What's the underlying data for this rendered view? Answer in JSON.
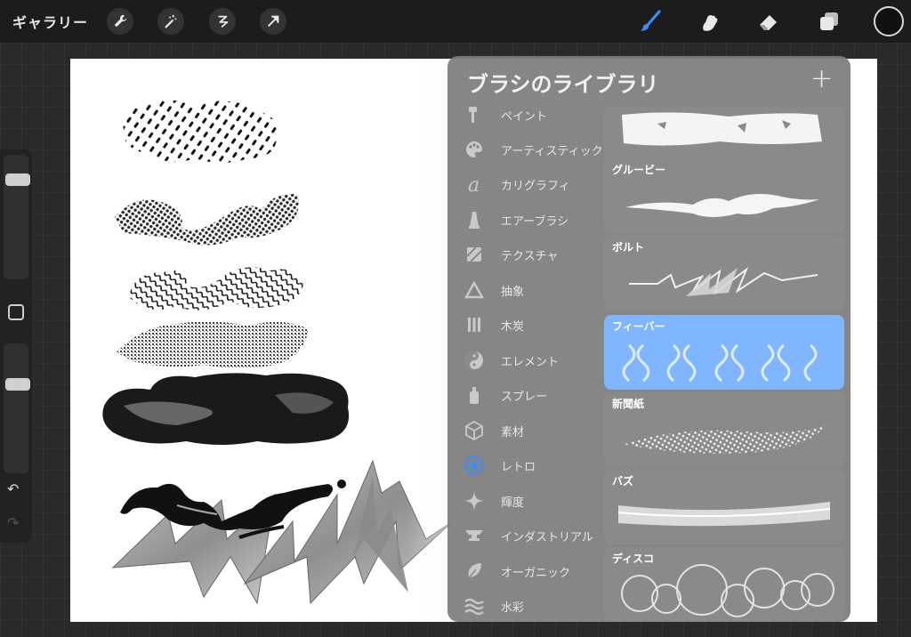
{
  "toolbar": {
    "gallery_label": "ギャラリー",
    "left_icons": [
      "wrench-icon",
      "magic-wand-icon",
      "selection-icon",
      "transform-arrow-icon"
    ],
    "right_icons": [
      "brush-icon",
      "smudge-icon",
      "eraser-icon",
      "layers-icon"
    ],
    "active_tool": "brush",
    "active_color": "#111111",
    "accent_color": "#3a8dff"
  },
  "sidebar": {
    "brush_size": 0.86,
    "opacity": 0.72,
    "icons": [
      "modify-square-icon",
      "undo-icon",
      "redo-icon"
    ],
    "undo_glyph": "↶",
    "redo_glyph": "↷"
  },
  "library": {
    "title": "ブラシのライブラリ",
    "add_glyph": "+",
    "categories": [
      {
        "label": "ペイント",
        "icon": "paint-icon"
      },
      {
        "label": "アーティスティック",
        "icon": "palette-icon"
      },
      {
        "label": "カリグラフィ",
        "icon": "calligraphy-icon"
      },
      {
        "label": "エアーブラシ",
        "icon": "airbrush-icon"
      },
      {
        "label": "テクスチャ",
        "icon": "texture-icon"
      },
      {
        "label": "抽象",
        "icon": "triangle-icon"
      },
      {
        "label": "木炭",
        "icon": "charcoal-icon"
      },
      {
        "label": "エレメント",
        "icon": "yin-yang-icon"
      },
      {
        "label": "スプレー",
        "icon": "spray-can-icon"
      },
      {
        "label": "素材",
        "icon": "cube-icon"
      },
      {
        "label": "レトロ",
        "icon": "star-badge-icon",
        "active": true
      },
      {
        "label": "輝度",
        "icon": "sparkle-icon"
      },
      {
        "label": "インダストリアル",
        "icon": "anvil-icon"
      },
      {
        "label": "オーガニック",
        "icon": "leaf-icon"
      },
      {
        "label": "水彩",
        "icon": "waves-icon"
      }
    ],
    "brushes": [
      {
        "name": ""
      },
      {
        "name": "グルービー"
      },
      {
        "name": "ボルト"
      },
      {
        "name": "フィーバー",
        "selected": true
      },
      {
        "name": "新聞紙"
      },
      {
        "name": "バズ"
      },
      {
        "name": "ディスコ"
      }
    ],
    "selected_color": "#7fb6ff"
  }
}
